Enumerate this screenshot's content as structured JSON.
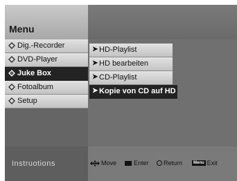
{
  "menu": {
    "title": "Menu"
  },
  "left_menu": {
    "items": [
      {
        "label": "Dig.-Recorder",
        "icon": "diamond-bullet-icon",
        "selected": false
      },
      {
        "label": "DVD-Player",
        "icon": "diamond-bullet-icon",
        "selected": false
      },
      {
        "label": "Juke Box",
        "icon": "diamond-bullet-icon",
        "selected": true
      },
      {
        "label": "Fotoalbum",
        "icon": "diamond-bullet-icon",
        "selected": false
      },
      {
        "label": "Setup",
        "icon": "diamond-bullet-icon",
        "selected": false
      }
    ]
  },
  "submenu": {
    "items": [
      {
        "label": "HD-Playlist",
        "icon": "arrow-right-icon",
        "selected": false
      },
      {
        "label": "HD bearbeiten",
        "icon": "arrow-right-icon",
        "selected": false
      },
      {
        "label": "CD-Playlist",
        "icon": "arrow-right-icon",
        "selected": false
      },
      {
        "label": "Kopie von CD auf HD",
        "icon": "arrow-right-icon",
        "selected": true
      }
    ]
  },
  "footer": {
    "instructions_label": "Instruotions",
    "move_label": "Move",
    "enter_label": "Enter",
    "return_label": "Return",
    "menu_key": "Menu",
    "exit_label": "Exit"
  },
  "colors": {
    "selected_bg": "#232323",
    "item_bg": "#d6d6d6",
    "panel_bg": "#6f6f6f"
  }
}
